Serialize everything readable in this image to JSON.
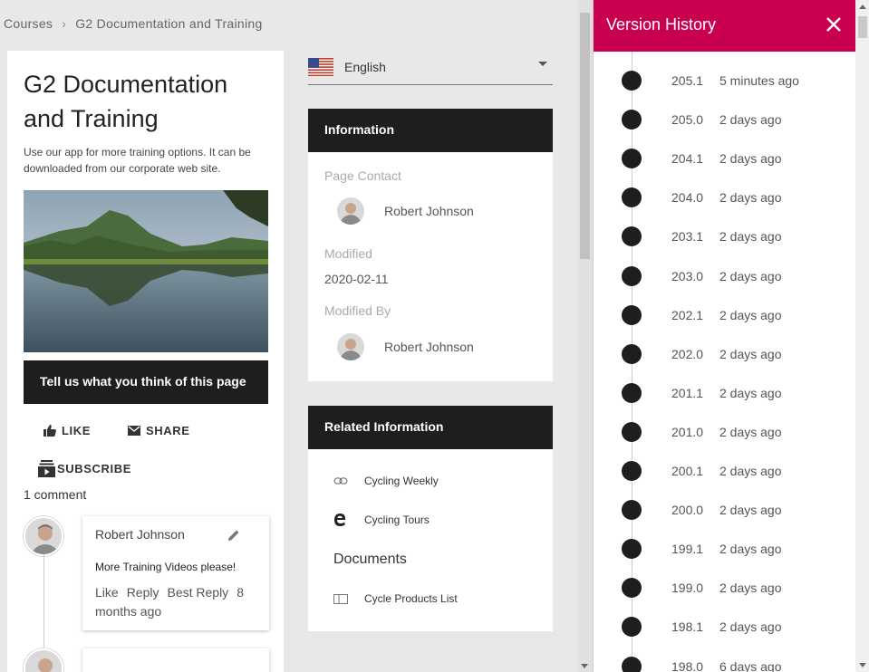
{
  "breadcrumb": {
    "parent": "Courses",
    "separator": "›",
    "current": "G2 Documentation and Training"
  },
  "page": {
    "title": "G2 Documentation and Training",
    "description": "Use our app for more training options. It can be downloaded from our corporate web site.",
    "hero_image_icon": "mountain-lake-image",
    "feedback_label": "Tell us what you think of this page"
  },
  "social": {
    "like": "LIKE",
    "share": "SHARE",
    "subscribe": "SUBSCRIBE",
    "comment_count": "1 comment"
  },
  "comment": {
    "author": "Robert Johnson",
    "text": "More Training Videos please!",
    "actions": {
      "like": "Like",
      "reply": "Reply",
      "best_reply": "Best Reply",
      "age": "8 months ago"
    }
  },
  "language": {
    "selected": "English"
  },
  "information": {
    "header": "Information",
    "contact_label": "Page Contact",
    "contact_name": "Robert Johnson",
    "modified_label": "Modified",
    "modified_value": "2020-02-11",
    "modified_by_label": "Modified By",
    "modified_by_name": "Robert Johnson"
  },
  "related": {
    "header": "Related Information",
    "links": [
      "Cycling Weekly",
      "Cycling Tours"
    ],
    "documents_header": "Documents",
    "documents": [
      "Cycle Products List"
    ]
  },
  "version_history": {
    "title": "Version History",
    "accent_color": "#c8004f",
    "entries": [
      {
        "version": "205.1",
        "time": "5 minutes ago"
      },
      {
        "version": "205.0",
        "time": "2 days ago"
      },
      {
        "version": "204.1",
        "time": "2 days ago"
      },
      {
        "version": "204.0",
        "time": "2 days ago"
      },
      {
        "version": "203.1",
        "time": "2 days ago"
      },
      {
        "version": "203.0",
        "time": "2 days ago"
      },
      {
        "version": "202.1",
        "time": "2 days ago"
      },
      {
        "version": "202.0",
        "time": "2 days ago"
      },
      {
        "version": "201.1",
        "time": "2 days ago"
      },
      {
        "version": "201.0",
        "time": "2 days ago"
      },
      {
        "version": "200.1",
        "time": "2 days ago"
      },
      {
        "version": "200.0",
        "time": "2 days ago"
      },
      {
        "version": "199.1",
        "time": "2 days ago"
      },
      {
        "version": "199.0",
        "time": "2 days ago"
      },
      {
        "version": "198.1",
        "time": "2 days ago"
      },
      {
        "version": "198.0",
        "time": "6 days ago"
      }
    ]
  }
}
